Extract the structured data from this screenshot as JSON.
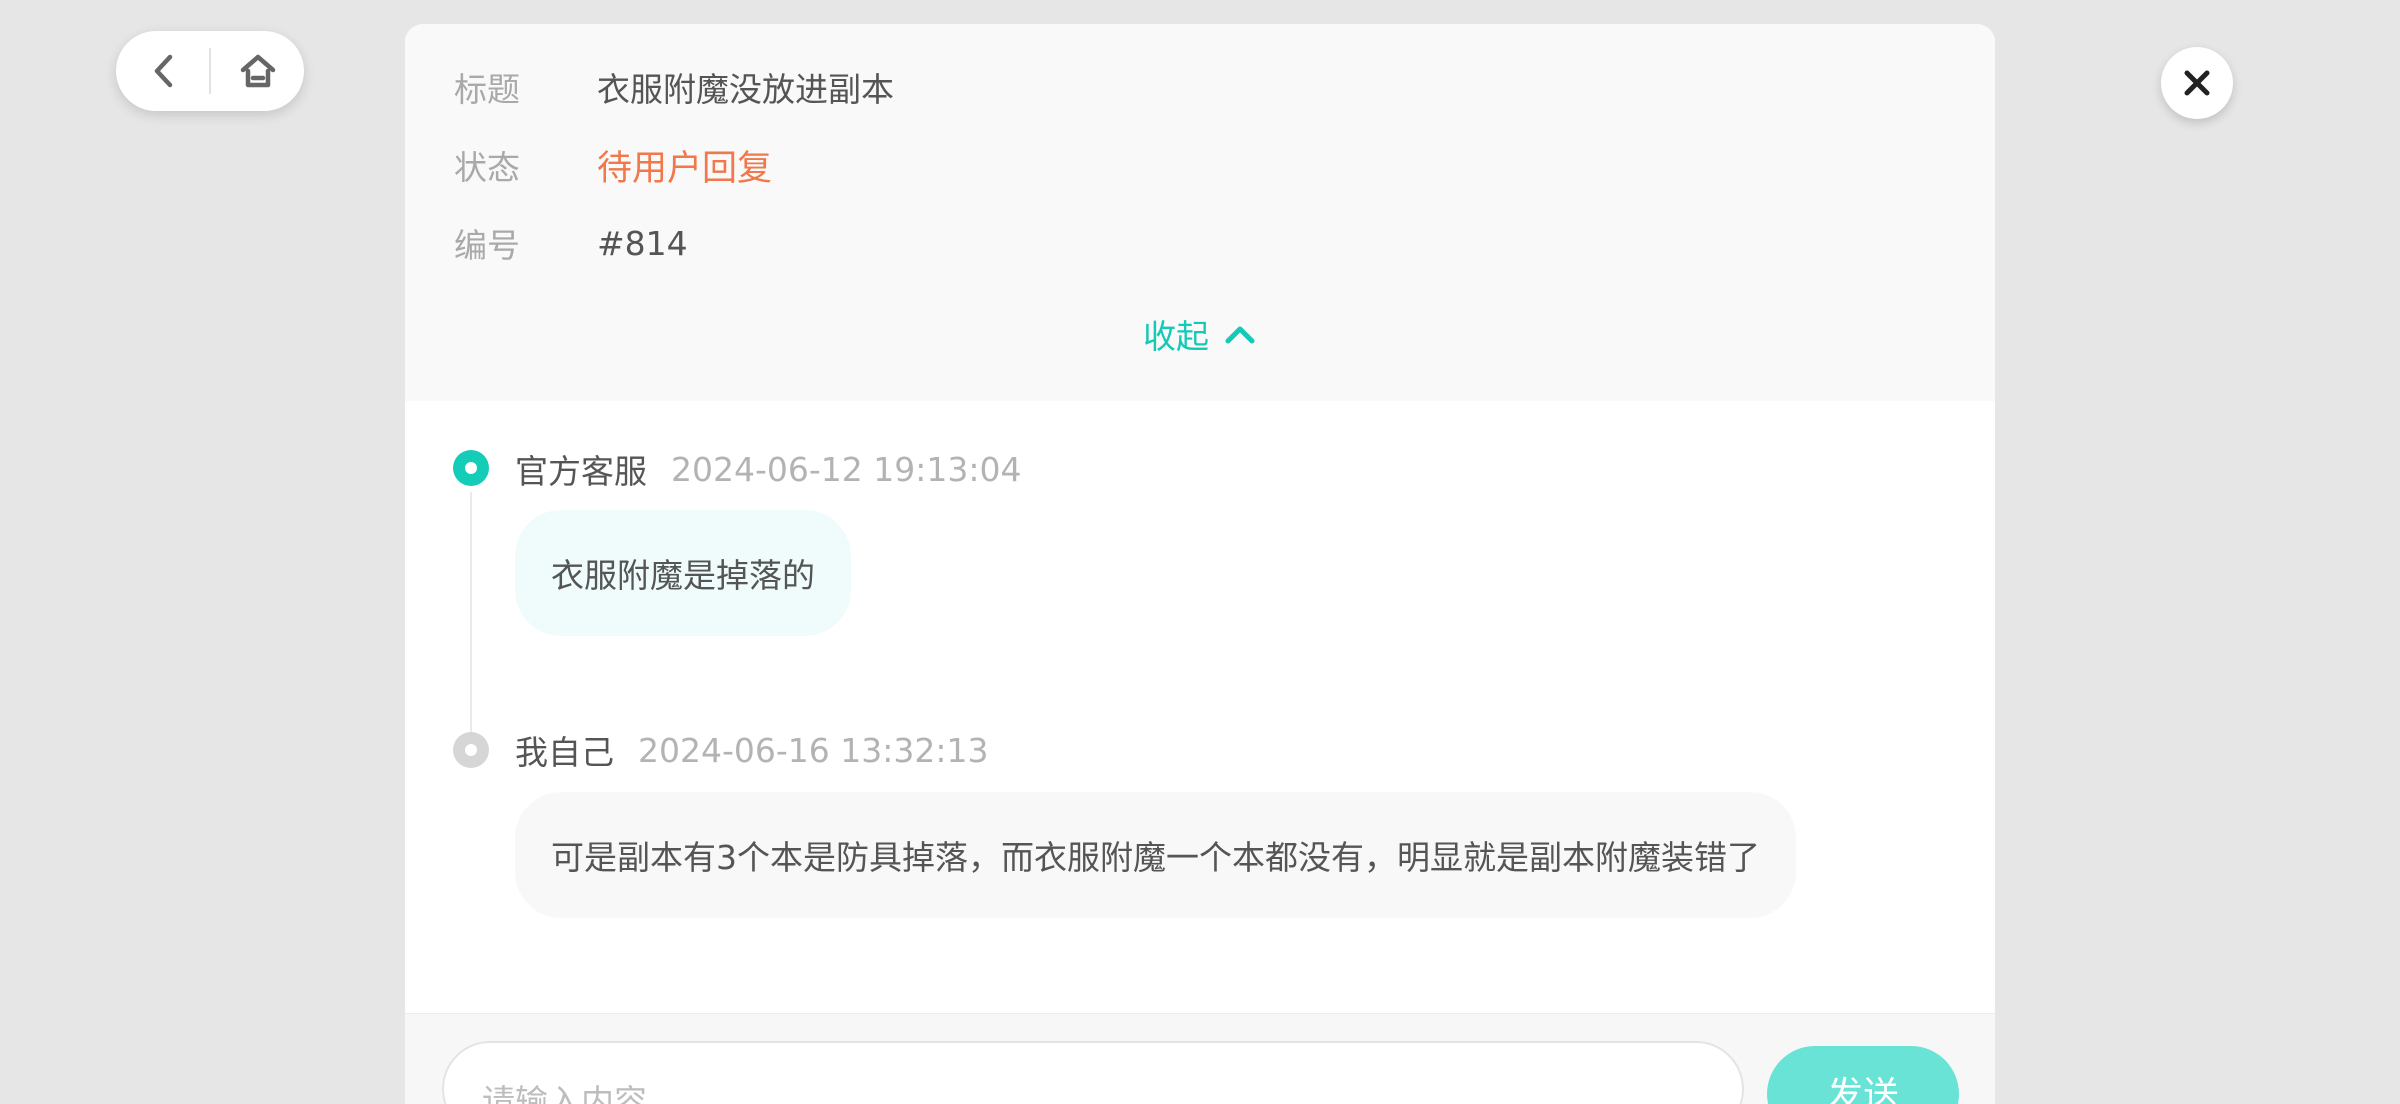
{
  "nav": {
    "back_icon": "chevron-left-icon",
    "home_icon": "home-icon"
  },
  "close_icon": "close-icon",
  "ticket": {
    "title_label": "标题",
    "title_value": "衣服附魔没放进副本",
    "status_label": "状态",
    "status_value": "待用户回复",
    "number_label": "编号",
    "number_value": "#814",
    "collapse_label": "收起",
    "collapse_icon": "chevron-up-icon"
  },
  "messages": [
    {
      "author": "官方客服",
      "time": "2024-06-12 19:13:04",
      "text": "衣服附魔是掉落的"
    },
    {
      "author": "我自己",
      "time": "2024-06-16 13:32:13",
      "text": "可是副本有3个本是防具掉落，而衣服附魔一个本都没有，明显就是副本附魔装错了"
    }
  ],
  "input": {
    "placeholder": "请输入内容",
    "send_label": "发送"
  },
  "colors": {
    "accent": "#14cdb8",
    "status": "#f0784a",
    "send_button": "#69e3d6",
    "official_bubble": "#effcfb",
    "my_bubble": "#f8f8f8"
  }
}
